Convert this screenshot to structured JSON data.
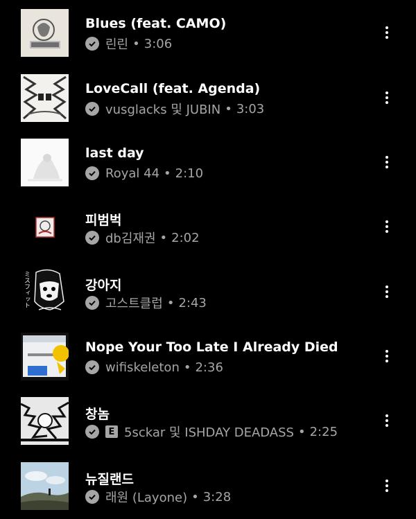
{
  "tracks": [
    {
      "title": "Blues (feat. CAMO)",
      "artist": "린린",
      "duration": "3:06",
      "explicit": false,
      "art": "album-art-blues"
    },
    {
      "title": "LoveCall (feat. Agenda)",
      "artist": "vusglacks 및 JUBIN",
      "duration": "3:03",
      "explicit": false,
      "art": "album-art-lovecall"
    },
    {
      "title": "last day",
      "artist": "Royal 44",
      "duration": "2:10",
      "explicit": false,
      "art": "album-art-last-day"
    },
    {
      "title": "피범벅",
      "artist": "db김재권",
      "duration": "2:02",
      "explicit": false,
      "art": "album-art-pibeombeok"
    },
    {
      "title": "강아지",
      "artist": "고스트클럽",
      "duration": "2:43",
      "explicit": false,
      "art": "album-art-gangaji",
      "art_text": "ミスフィット"
    },
    {
      "title": "Nope Your Too Late I Already Died",
      "artist": "wifiskeleton",
      "duration": "2:36",
      "explicit": false,
      "art": "album-art-nope"
    },
    {
      "title": "창놈",
      "artist": "5sckar 및 ISHDAY DEADASS",
      "duration": "2:25",
      "explicit": true,
      "explicit_label": "E",
      "art": "album-art-changnom"
    },
    {
      "title": "뉴질랜드",
      "artist": "래원 (Layone)",
      "duration": "3:28",
      "explicit": false,
      "art": "album-art-new-zealand"
    }
  ],
  "separator": "•",
  "icons": {
    "downloaded": "check-circle-icon",
    "more": "more-vert-icon"
  },
  "colors": {
    "background": "#000000",
    "title": "#ffffff",
    "subtitle": "#a6a6a6"
  }
}
